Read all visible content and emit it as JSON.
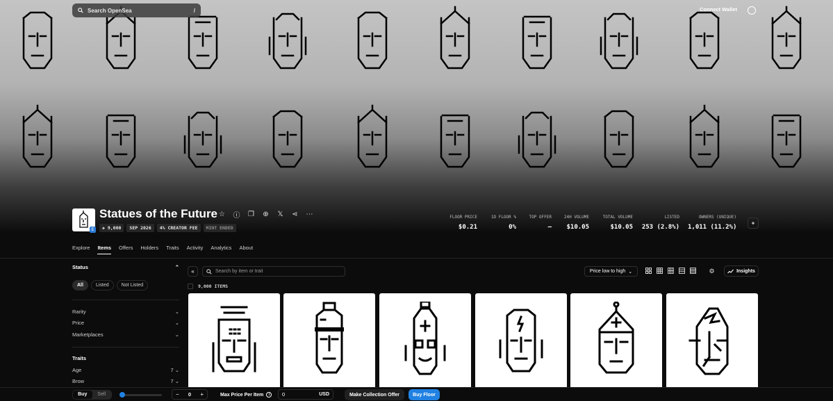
{
  "topbar": {
    "search_placeholder": "Search OpenSea",
    "search_shortcut": "/",
    "connect_label": "Connect Wallet",
    "account_icon": "account-circle-icon"
  },
  "collection": {
    "title": "Statues of the Future",
    "logo_badge": "E",
    "chips": {
      "items": "9,000",
      "date": "SEP 2026",
      "fee": "4% CREATOR FEE",
      "status": "MINT ENDED"
    },
    "title_icons": [
      "star-icon",
      "info-icon",
      "copy-icon",
      "globe-icon",
      "x-icon",
      "share-icon",
      "more-icon"
    ]
  },
  "stats": [
    {
      "label": "FLOOR PRICE",
      "value": "$0.21"
    },
    {
      "label": "1D FLOOR %",
      "value": "0%"
    },
    {
      "label": "TOP OFFER",
      "value": "–"
    },
    {
      "label": "24H VOLUME",
      "value": "$10.05"
    },
    {
      "label": "TOTAL VOLUME",
      "value": "$10.05"
    },
    {
      "label": "LISTED",
      "value": "253 (2.8%)"
    },
    {
      "label": "OWNERS (UNIQUE)",
      "value": "1,011 (11.2%)"
    }
  ],
  "tabs": {
    "explore": "Explore",
    "items": "Items",
    "offers": "Offers",
    "holders": "Holders",
    "traits": "Traits",
    "activity": "Activity",
    "analytics": "Analytics",
    "about": "About",
    "active": "Items"
  },
  "sidebar": {
    "status_title": "Status",
    "status_all": "All",
    "status_listed": "Listed",
    "status_not_listed": "Not Listed",
    "rarity": "Rarity",
    "price": "Price",
    "marketplaces": "Marketplaces",
    "traits_title": "Traits",
    "trait_age": "Age",
    "trait_age_count": "7",
    "trait_brow": "Brow",
    "trait_brow_count": "7"
  },
  "toolbar": {
    "search_placeholder": "Search by item or trait",
    "sort_label": "Price low to high",
    "insights_label": "Insights",
    "item_count": "9,000 ITEMS"
  },
  "bottom": {
    "buy": "Buy",
    "sell": "Sell",
    "quantity": "0",
    "decrement": "−",
    "increment": "+",
    "max_price_label": "Max Price Per Item",
    "price_value": "0",
    "currency": "USD",
    "offer_button": "Make Collection Offer",
    "buy_floor": "Buy Floor"
  },
  "colors": {
    "accent": "#2081e2",
    "background": "#0c0c0c",
    "banner_top": "#c4c4c4"
  }
}
